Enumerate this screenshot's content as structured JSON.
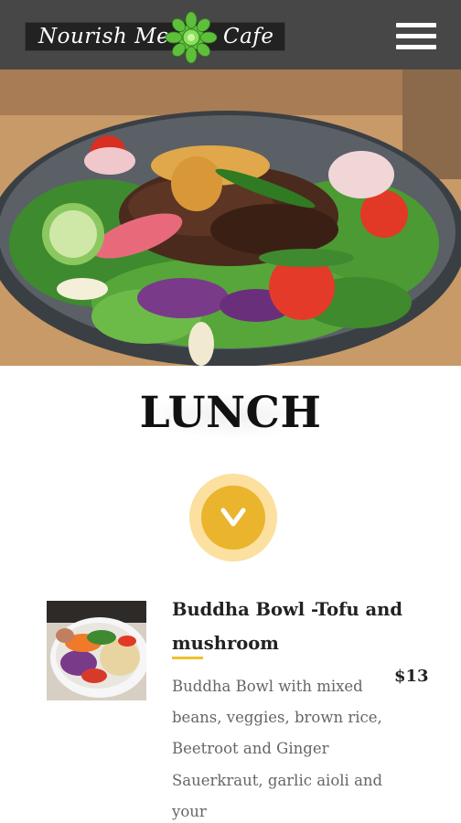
{
  "header": {
    "logo_left": "Nourish Me",
    "logo_right": "Cafe",
    "menu_icon": "hamburger-menu-icon",
    "colors": {
      "bar": "#474747",
      "logo_green": "#5fbf3b"
    }
  },
  "hero": {
    "image": "beef-salad-bowl-photo"
  },
  "section": {
    "title": "LUNCH",
    "toggle_icon": "chevron-down-icon",
    "accent_color": "#eab42c"
  },
  "menu_items": [
    {
      "name": "Buddha Bowl -Tofu and mushroom",
      "price": "$13",
      "description": "Buddha Bowl with mixed beans, veggies, brown rice, Beetroot and Ginger Sauerkraut, garlic aioli and your",
      "image": "buddha-bowl-photo"
    }
  ]
}
